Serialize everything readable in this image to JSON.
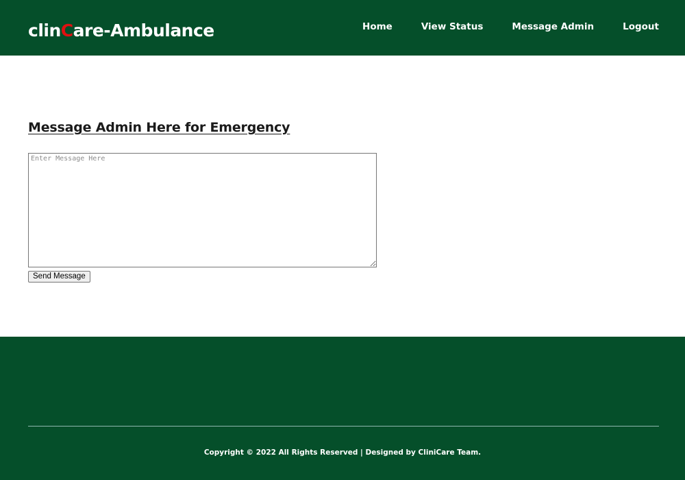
{
  "header": {
    "brand_prefix": "clin",
    "brand_accent": "C",
    "brand_suffix": "are-Ambulance",
    "nav": [
      {
        "label": "Home"
      },
      {
        "label": "View Status"
      },
      {
        "label": "Message Admin"
      },
      {
        "label": "Logout"
      }
    ]
  },
  "main": {
    "title": "Message Admin Here for Emergency",
    "message_placeholder": "Enter Message Here",
    "message_value": "",
    "send_label": "Send Message"
  },
  "footer": {
    "copyright": "Copyright © 2022 All Rights Reserved | Designed by CliniCare Team."
  },
  "colors": {
    "brand_green": "#054f2a",
    "accent_red": "#e01010",
    "text_white": "#ffffff"
  }
}
